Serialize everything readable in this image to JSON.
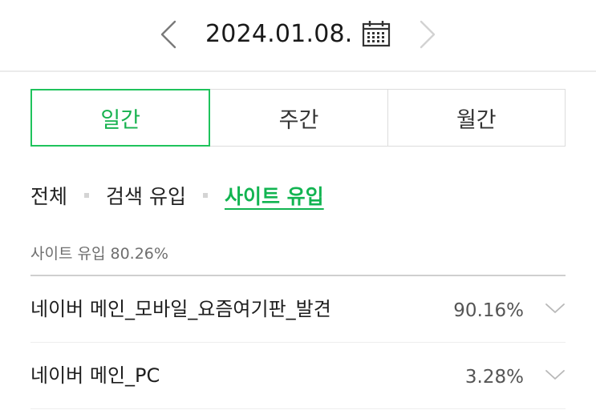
{
  "date_nav": {
    "date": "2024.01.08.",
    "prev_icon": "chevron-left-icon",
    "next_icon": "chevron-right-icon",
    "calendar_icon": "calendar-icon"
  },
  "period_tabs": [
    {
      "label": "일간",
      "active": true
    },
    {
      "label": "주간",
      "active": false
    },
    {
      "label": "월간",
      "active": false
    }
  ],
  "filters": [
    {
      "label": "전체",
      "active": false
    },
    {
      "label": "검색 유입",
      "active": false
    },
    {
      "label": "사이트 유입",
      "active": true
    }
  ],
  "summary": "사이트 유입 80.26%",
  "rows": [
    {
      "name": "네이버 메인_모바일_요즘여기판_발견",
      "value": "90.16%"
    },
    {
      "name": "네이버 메인_PC",
      "value": "3.28%"
    }
  ],
  "colors": {
    "accent": "#1fc35c",
    "accent_text": "#12b451",
    "border": "#dcdcdc"
  }
}
